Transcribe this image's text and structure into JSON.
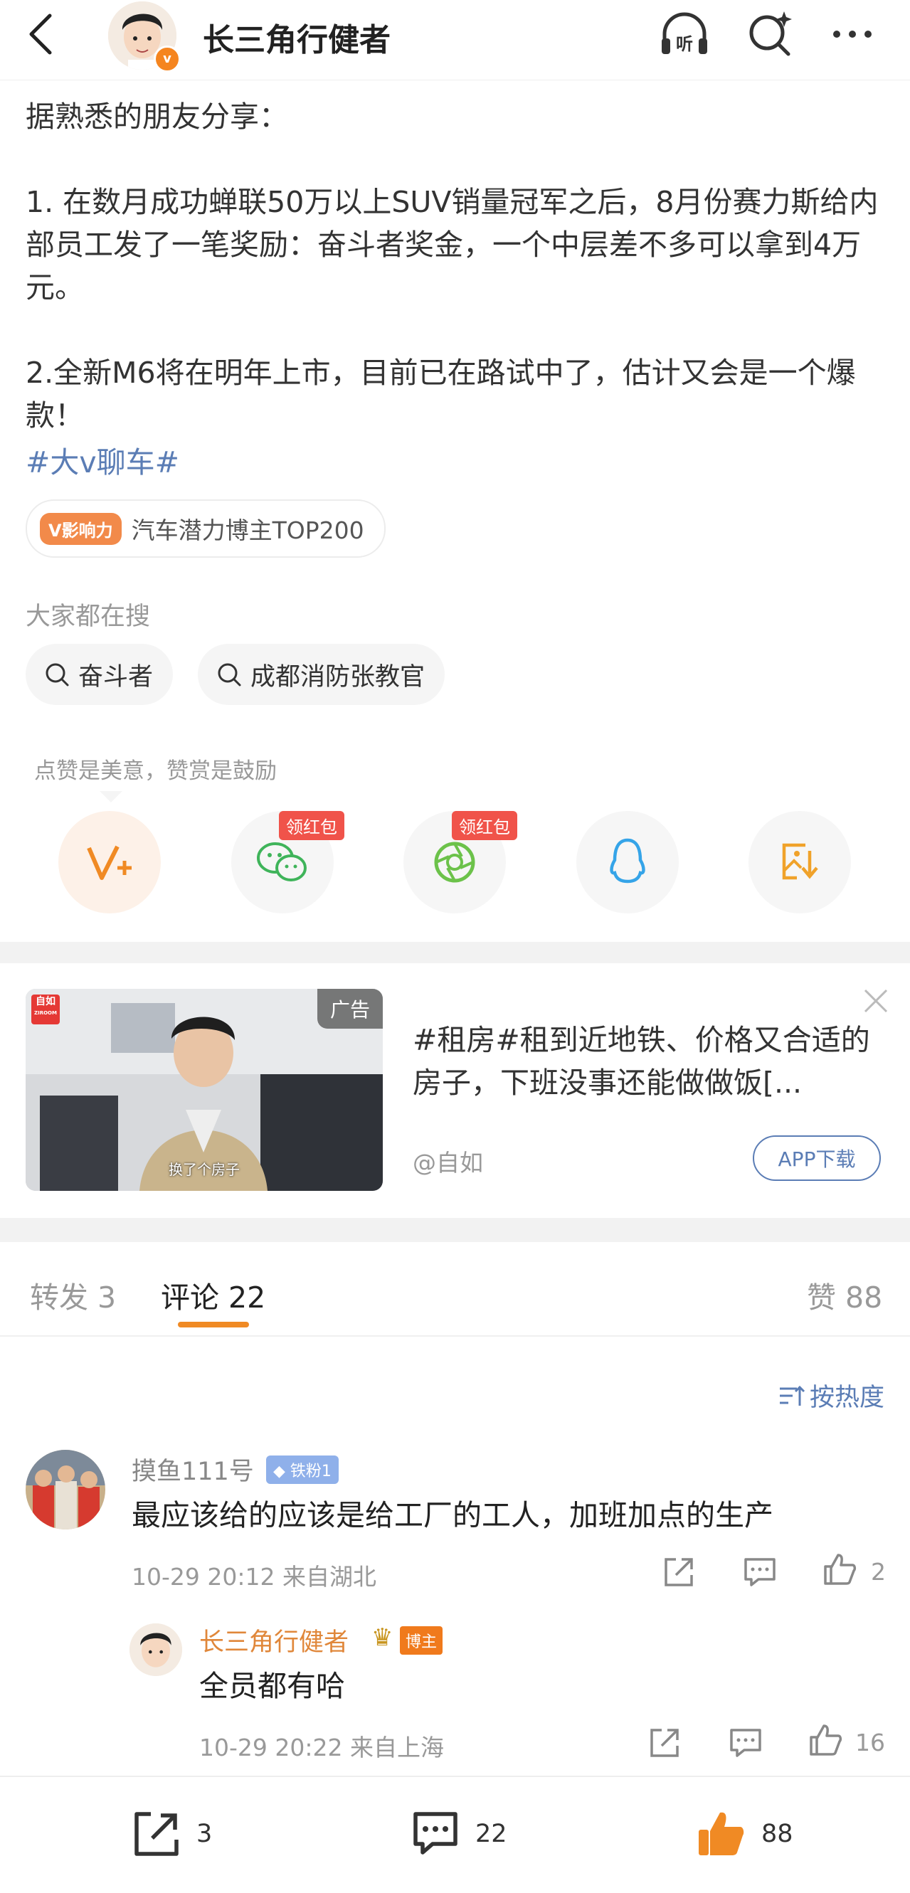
{
  "header": {
    "title": "长三角行健者",
    "avatar_badge": "v"
  },
  "post": {
    "lines": [
      "据熟悉的朋友分享：",
      "",
      "1. 在数月成功蝉联50万以上SUV销量冠军之后，8月份赛力斯给内部员工发了一笔奖励：奋斗者奖金，一个中层差不多可以拿到4万元。",
      "",
      "2.全新M6将在明年上市，目前已在路试中了，估计又会是一个爆款！"
    ],
    "topic": "#大v聊车#",
    "influence_badge": "V影响力",
    "influence_text": "汽车潜力博主TOP200"
  },
  "searches": {
    "label": "大家都在搜",
    "items": [
      "奋斗者",
      "成都消防张教官"
    ]
  },
  "share": {
    "hint": "点赞是美意，赞赏是鼓励",
    "redpack_label": "领红包"
  },
  "ad": {
    "tag": "广告",
    "logo": "自如",
    "logo_sub": "ZIROOM",
    "video_caption": "换了个房子",
    "title": "#租房#租到近地铁、价格又合适的房子，下班没事还能做做饭[...",
    "source": "@自如",
    "download": "APP下载"
  },
  "tabs": {
    "repost": "转发 3",
    "comments": "评论 22",
    "likes": "赞 88"
  },
  "sort_label": "按热度",
  "comments": [
    {
      "name": "摸鱼111号",
      "badge": "铁粉1",
      "text": "最应该给的应该是给工厂的工人，加班加点的生产",
      "time": "10-29 20:12  来自湖北",
      "likes": "2"
    },
    {
      "name": "长三角行健者",
      "badge": "博主",
      "text": "全员都有哈",
      "time": "10-29 20:22  来自上海",
      "likes": "16"
    }
  ],
  "bottom": {
    "repost": "3",
    "comment": "22",
    "like": "88"
  },
  "colors": {
    "accent_orange": "#f08a24",
    "link_blue": "#5b7db5",
    "redpack_red": "#f0534a"
  }
}
